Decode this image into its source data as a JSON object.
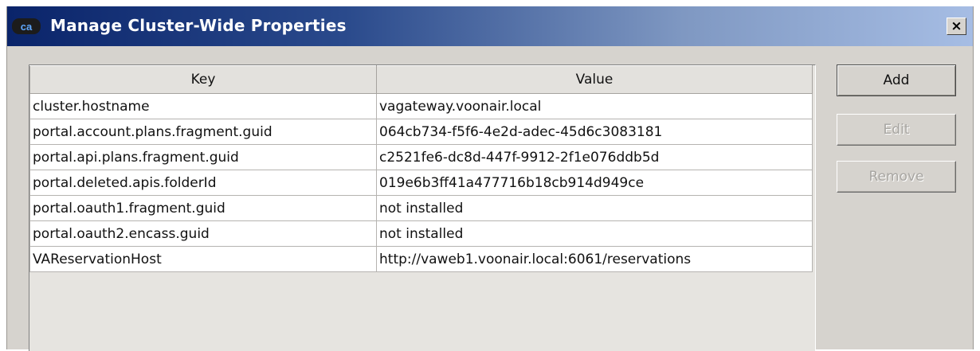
{
  "window": {
    "title": "Manage Cluster-Wide Properties",
    "icon_text": "ca",
    "close_symbol": "×"
  },
  "table": {
    "columns": [
      "Key",
      "Value"
    ],
    "rows": [
      {
        "key": "cluster.hostname",
        "value": "vagateway.voonair.local"
      },
      {
        "key": "portal.account.plans.fragment.guid",
        "value": "064cb734-f5f6-4e2d-adec-45d6c3083181"
      },
      {
        "key": "portal.api.plans.fragment.guid",
        "value": "c2521fe6-dc8d-447f-9912-2f1e076ddb5d"
      },
      {
        "key": "portal.deleted.apis.folderId",
        "value": "019e6b3ff41a477716b18cb914d949ce"
      },
      {
        "key": "portal.oauth1.fragment.guid",
        "value": "not installed"
      },
      {
        "key": "portal.oauth2.encass.guid",
        "value": "not installed"
      },
      {
        "key": "VAReservationHost",
        "value": "http://vaweb1.voonair.local:6061/reservations"
      }
    ]
  },
  "buttons": {
    "add": "Add",
    "edit": "Edit",
    "remove": "Remove"
  },
  "colors": {
    "titlebar_start": "#0a246a",
    "titlebar_end": "#a6bde4",
    "dialog_bg": "#d6d3ce",
    "disabled_text": "#a7a5a1"
  }
}
